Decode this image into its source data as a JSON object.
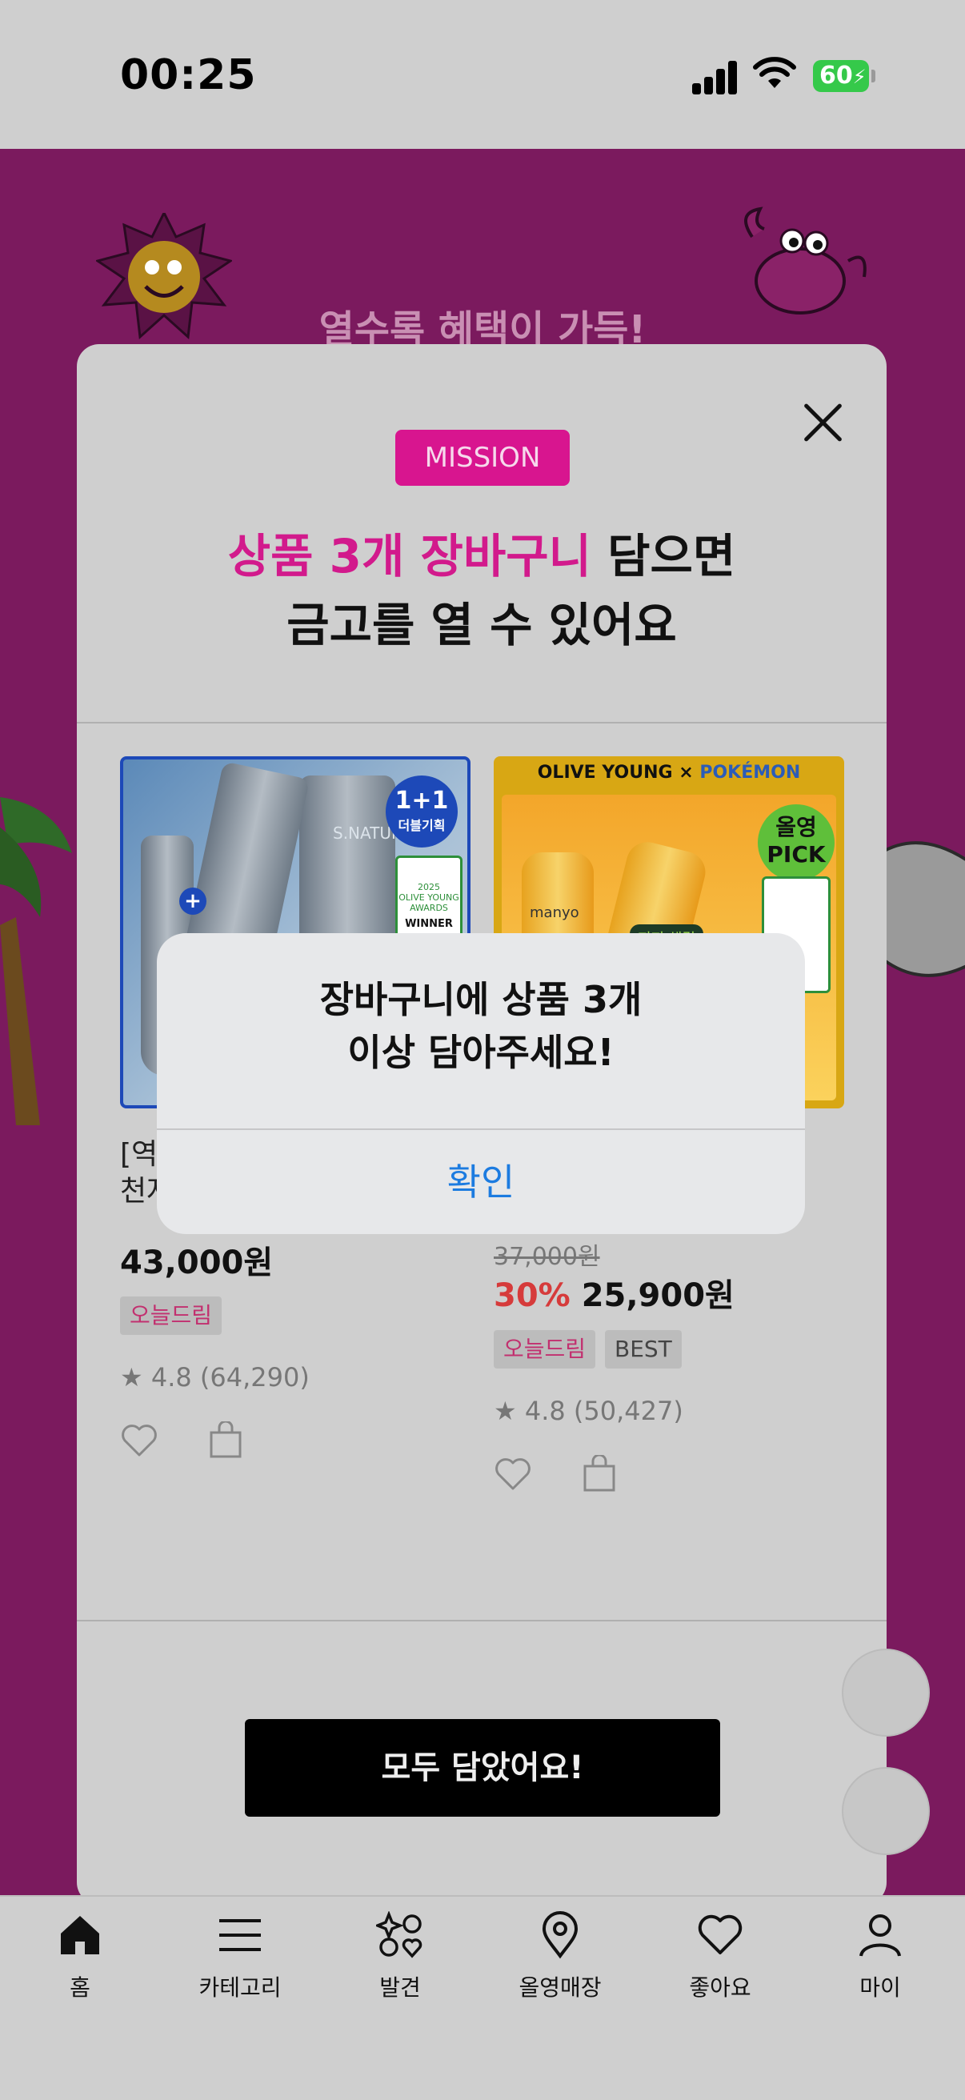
{
  "status_bar": {
    "time": "00:25",
    "battery": "60"
  },
  "promo": {
    "title": "열수록 혜택이 가득!"
  },
  "modal": {
    "badge": "MISSION",
    "headline_line1_highlight": "상품 3개 장바구니",
    "headline_line1_rest": " 담으면",
    "headline_line2": "금고를 열 수 있어요",
    "products": [
      {
        "image_badge": "1+1",
        "image_badge_sub": "더블기획",
        "image_brand": "S.NATURE",
        "award_text": "OLIVE YOUNG AWARDS",
        "award_year": "2025",
        "award_winner": "WINNER",
        "name_visible": "[역\n천자",
        "price": "43,000원",
        "tags": [
          "오늘드림"
        ],
        "rating": "4.8 (64,290)"
      },
      {
        "image_header_left": "OLIVE YOUNG",
        "image_header_x": "×",
        "image_header_right": "POKÉMON",
        "image_badge": "올영\nPICK",
        "image_brand": "manyo",
        "image_caption": "피지 해결",
        "old_price": "37,000원",
        "discount": "30%",
        "price": "25,900원",
        "tags": [
          "오늘드림",
          "BEST"
        ],
        "rating": "4.8 (50,427)"
      }
    ],
    "cta": "모두 담았어요!"
  },
  "alert": {
    "message_line1": "장바구니에 상품 3개",
    "message_line2": "이상 담아주세요!",
    "confirm": "확인"
  },
  "tabbar": {
    "items": [
      {
        "label": "홈",
        "icon": "home-icon"
      },
      {
        "label": "카테고리",
        "icon": "menu-icon"
      },
      {
        "label": "발견",
        "icon": "discover-icon"
      },
      {
        "label": "올영매장",
        "icon": "location-pin-icon"
      },
      {
        "label": "좋아요",
        "icon": "heart-icon"
      },
      {
        "label": "마이",
        "icon": "person-icon"
      }
    ]
  },
  "colors": {
    "promo_bg": "#7b1a5e",
    "mission_pink": "#d21a8c",
    "link_blue": "#1c7be0",
    "discount_red": "#d63b3b"
  }
}
